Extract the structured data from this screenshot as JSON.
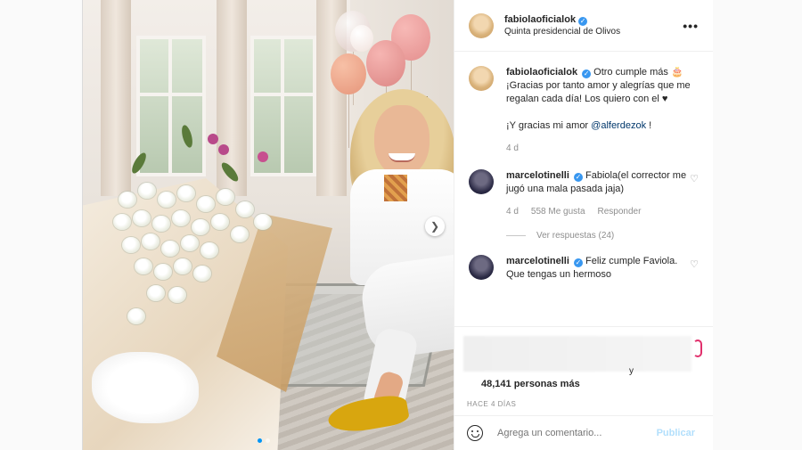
{
  "post": {
    "username": "fabiolaoficialok",
    "location": "Quinta presidencial de Olivos",
    "more": "•••"
  },
  "caption": {
    "username": "fabiolaoficialok",
    "text_1": "Otro cumple más 🎂 ¡Gracias por tanto amor y alegrías que me regalan cada día! Los quiero con el ♥",
    "text_2_prefix": "¡Y gracias mi amor ",
    "mention": "@alferdezok",
    "text_2_suffix": " !",
    "time": "4 d"
  },
  "comments": [
    {
      "username": "marcelotinelli",
      "text": "Fabiola(el corrector me jugó una mala pasada jaja)",
      "time": "4 d",
      "likes": "558 Me gusta",
      "reply": "Responder",
      "view_replies": "Ver respuestas (24)"
    },
    {
      "username": "marcelotinelli",
      "text": "Feliz cumple Faviola. Que tengas un hermoso"
    }
  ],
  "actions": {
    "likes_tail": "y",
    "likes": "48,141 personas más",
    "when": "HACE 4 DÍAS"
  },
  "add_comment": {
    "placeholder": "Agrega un comentario...",
    "publish": "Publicar"
  },
  "icons": {
    "verified": "verified-badge-icon",
    "heart": "heart-outline-icon",
    "emoji": "emoji-icon",
    "next": "chevron-right-icon"
  }
}
